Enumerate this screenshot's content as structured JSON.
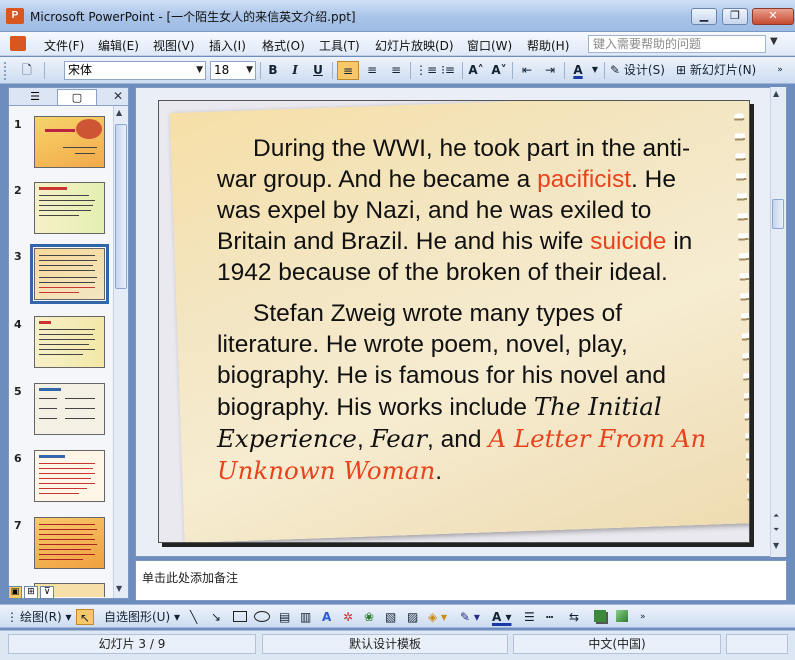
{
  "window": {
    "app_icon_text": "P",
    "title": "Microsoft PowerPoint - [一个陌生女人的来信英文介绍.ppt]",
    "minimize": "▁",
    "maximize": "❐",
    "close": "✕"
  },
  "menu": {
    "items": [
      "文件(F)",
      "编辑(E)",
      "视图(V)",
      "插入(I)",
      "格式(O)",
      "工具(T)",
      "幻灯片放映(D)",
      "窗口(W)",
      "帮助(H)"
    ],
    "help_placeholder": "键入需要帮助的问题"
  },
  "toolbar": {
    "font": "宋体",
    "size": "18",
    "bold": "B",
    "italic": "I",
    "underline": "U",
    "design": "设计(S)",
    "new_slide": "新幻灯片(N)"
  },
  "thumbnails": {
    "numbers": [
      "1",
      "2",
      "3",
      "4",
      "5",
      "6",
      "7"
    ],
    "selected": "3"
  },
  "slide": {
    "para1": {
      "t1": "During the WWI, he took part in the anti-war group. And he became a ",
      "t2": "pacificist",
      "t3": ". He was expel by Nazi, and he was exiled to Britain and Brazil. He and his wife ",
      "t4": "suicide",
      "t5": " in 1942 because of the broken of their ideal."
    },
    "para2": {
      "t1": "Stefan Zweig wrote many types of literature. He wrote poem, novel, play, biography. He is famous for his novel and biography. His works include ",
      "t2": "The Initial Experience",
      "t3": ", ",
      "t4": "Fear",
      "t5": ", and ",
      "t6": "A Letter From An Unknown Woman",
      "t7": "."
    },
    "accent_color": "#e8431d"
  },
  "notes": {
    "placeholder": "单击此处添加备注"
  },
  "drawbar": {
    "draw": "绘图(R)",
    "autoshapes": "自选图形(U)"
  },
  "status": {
    "slide": "幻灯片 3 / 9",
    "template": "默认设计模板",
    "language": "中文(中国)"
  }
}
